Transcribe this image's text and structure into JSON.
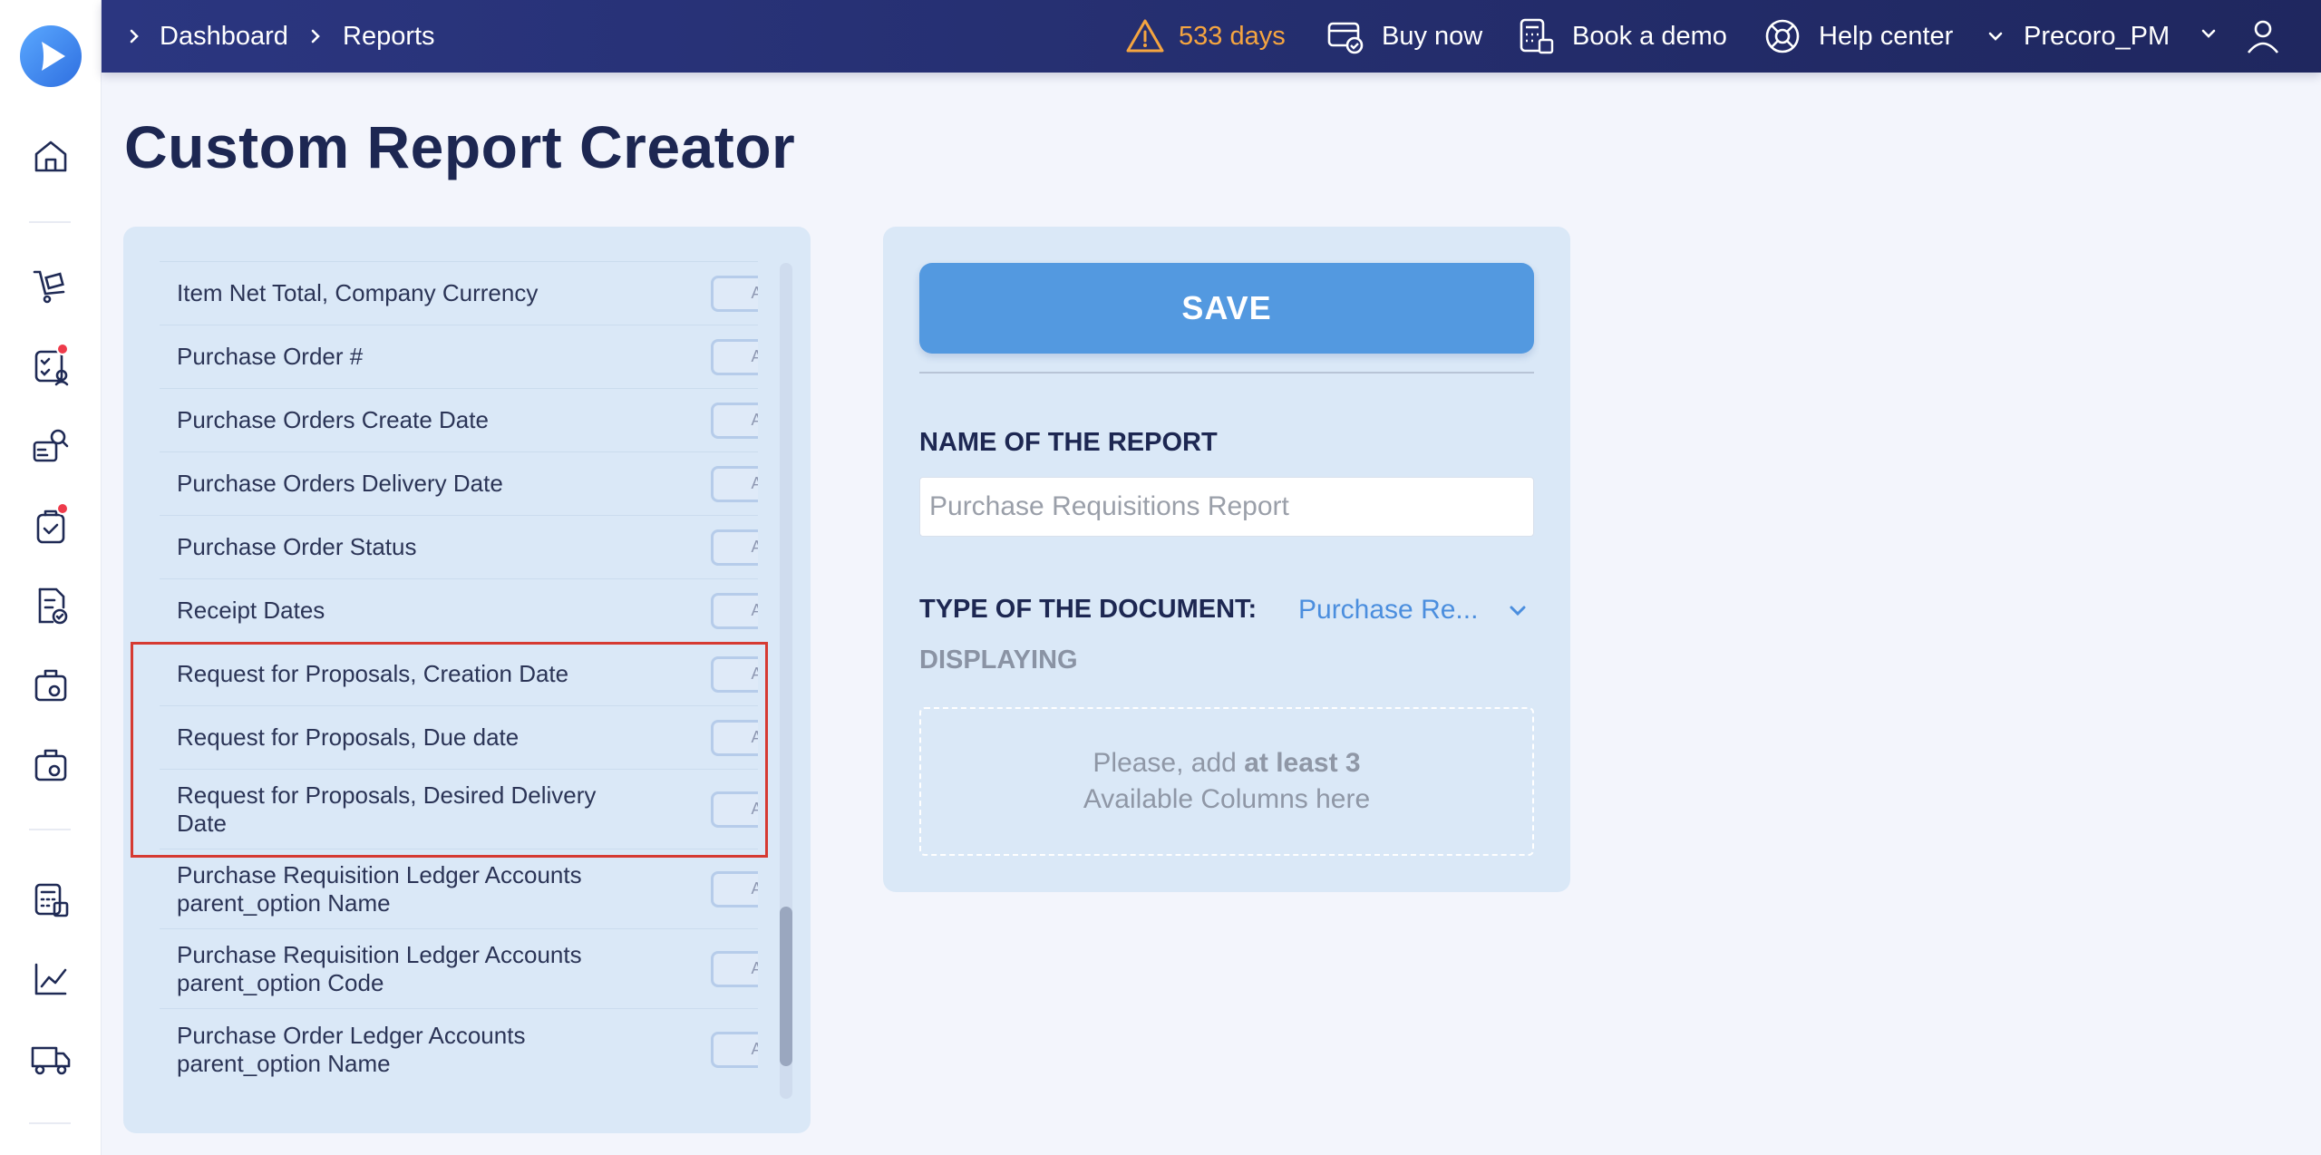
{
  "breadcrumb": [
    "Dashboard",
    "Reports"
  ],
  "topbar": {
    "trial_days": "533 days",
    "buy_now": "Buy now",
    "book_demo": "Book a demo",
    "help_center": "Help center",
    "user": "Precoro_PM"
  },
  "page": {
    "title": "Custom Report Creator"
  },
  "columns": {
    "add_label": "ADD",
    "items": [
      "Item Net Total, Company Currency",
      "Purchase Order #",
      "Purchase Orders Create Date",
      "Purchase Orders Delivery Date",
      "Purchase Order Status",
      "Receipt Dates",
      "Request for Proposals, Creation Date",
      "Request for Proposals, Due date",
      "Request for Proposals, Desired Delivery Date",
      "Purchase Requisition Ledger Accounts parent_option Name",
      "Purchase Requisition Ledger Accounts parent_option Code",
      "Purchase Order Ledger Accounts parent_option Name"
    ],
    "highlighted": [
      6,
      7,
      8
    ]
  },
  "report": {
    "save_label": "SAVE",
    "name_label": "NAME OF THE REPORT",
    "name_placeholder": "Purchase Requisitions Report",
    "type_label": "TYPE OF THE DOCUMENT:",
    "type_value": "Purchase Re...",
    "displaying_label": "DISPLAYING",
    "dropzone_pre": "Please, add ",
    "dropzone_bold": "at least 3",
    "dropzone_line2": "Available Columns here"
  },
  "colors": {
    "topbar": "#2b3680",
    "accent": "#5399e0",
    "warning": "#f5a540",
    "highlight": "#d63a32",
    "panel": "#dae8f7"
  }
}
